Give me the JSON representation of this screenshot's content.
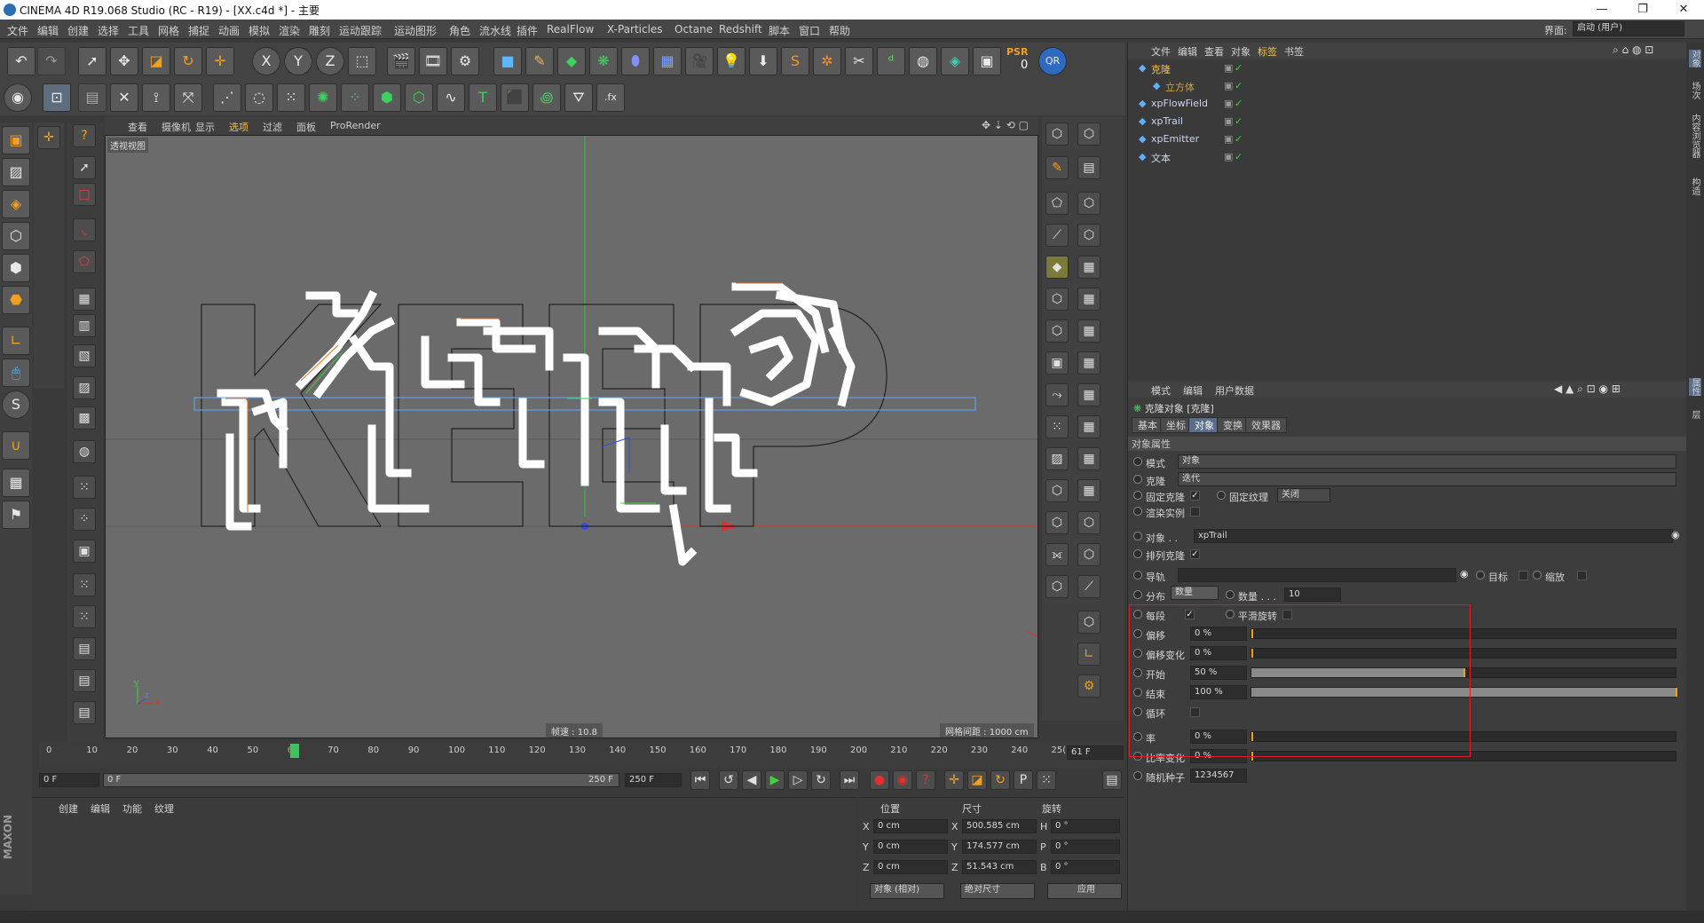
{
  "window": {
    "title": "CINEMA 4D R19.068 Studio (RC - R19) - [XX.c4d *] - 主要",
    "min": "—",
    "max": "❐",
    "close": "✕",
    "layout_label": "界面:",
    "layout_value": "启动 (用户)"
  },
  "menu": [
    "文件",
    "编辑",
    "创建",
    "选择",
    "工具",
    "网格",
    "捕捉",
    "动画",
    "模拟",
    "渲染",
    "雕刻",
    "运动跟踪",
    "运动图形",
    "角色",
    "流水线",
    "插件",
    "RealFlow",
    "X-Particles",
    "Octane",
    "Redshift",
    "脚本",
    "窗口",
    "帮助"
  ],
  "toolbar": {
    "x": "X",
    "y": "Y",
    "z": "Z",
    "psr": "PSR",
    "psr_val": "0",
    "qr": "QR",
    "fx": ".fx"
  },
  "viewport": {
    "menu": [
      "查看",
      "摄像机",
      "显示",
      "选项",
      "过滤",
      "面板",
      "ProRender"
    ],
    "label": "透视视图",
    "fps": "帧速 : 10.8",
    "grid": "网格间距 : 1000 cm",
    "axis_y": "y",
    "axis_x": "x",
    "axis_z": "z"
  },
  "timeline": {
    "ticks": [
      "0",
      "10",
      "20",
      "30",
      "40",
      "50",
      "61",
      "70",
      "80",
      "90",
      "100",
      "110",
      "120",
      "130",
      "140",
      "150",
      "160",
      "170",
      "180",
      "190",
      "200",
      "210",
      "220",
      "230",
      "240",
      "25("
    ],
    "current": "61 F",
    "start": "0 F",
    "range_start": "0 F",
    "range_end": "250 F",
    "end": "250 F",
    "marker_label": "6"
  },
  "bottom": {
    "tabs": [
      "创建",
      "编辑",
      "功能",
      "纹理"
    ],
    "maxon": "MAXON",
    "c4d": "CINEMA 4D"
  },
  "coords": {
    "h1": "位置",
    "h2": "尺寸",
    "h3": "旋转",
    "rows": [
      {
        "a": "X",
        "p": "0 cm",
        "s": "500.585 cm",
        "r": "H",
        "rv": "0 °"
      },
      {
        "a": "Y",
        "p": "0 cm",
        "s": "174.577 cm",
        "r": "P",
        "rv": "0 °"
      },
      {
        "a": "Z",
        "p": "0 cm",
        "s": "51.543 cm",
        "r": "B",
        "rv": "0 °"
      }
    ],
    "mode": "对象 (相对)",
    "size_mode": "绝对尺寸",
    "apply": "应用"
  },
  "objmgr": {
    "tabs": [
      "文件",
      "编辑",
      "查看",
      "对象",
      "标签",
      "书签"
    ],
    "objects": [
      {
        "name": "克隆",
        "indent": 0
      },
      {
        "name": "立方体",
        "indent": 1
      },
      {
        "name": "xpFlowField",
        "indent": 0
      },
      {
        "name": "xpTrail",
        "indent": 0
      },
      {
        "name": "xpEmitter",
        "indent": 0
      },
      {
        "name": "文本",
        "indent": 0
      }
    ]
  },
  "attr": {
    "tabs_top": [
      "模式",
      "编辑",
      "用户数据"
    ],
    "title": "克隆对象 [克隆]",
    "tabs": [
      "基本",
      "坐标",
      "对象",
      "变换",
      "效果器"
    ],
    "section": "对象属性",
    "mode_label": "模式",
    "mode_value": "对象",
    "clone_label": "克隆",
    "clone_value": "迭代",
    "fixed_clone": "固定克隆",
    "fixed_tex": "固定纹理",
    "fixed_tex_value": "关闭",
    "render_inst": "渲染实例",
    "object_label": "对象 . .",
    "object_value": "xpTrail",
    "arrange": "排列克隆",
    "guide": "导轨",
    "target": "目标",
    "scale": "缩放",
    "dist_label": "分布",
    "dist_value": "数量",
    "count_label": "数量 . . .",
    "count_value": "10",
    "per_seg": "每段",
    "smooth": "平滑旋转",
    "offset_label": "偏移",
    "offset_value": "0 %",
    "offvar_label": "偏移变化",
    "offvar_value": "0 %",
    "start_label": "开始",
    "start_value": "50 %",
    "start_pct": 0.5,
    "end_label": "结束",
    "end_value": "100 %",
    "end_pct": 1.0,
    "loop": "循环",
    "rate_label": "率",
    "rate_value": "0 %",
    "ratevar_label": "比率变化",
    "ratevar_value": "0 %",
    "seed_label": "随机种子",
    "seed_value": "1234567"
  },
  "sidetabs": [
    "对象",
    "场次",
    "内容浏览器",
    "构造"
  ],
  "sidetabs2": [
    "属性",
    "层"
  ]
}
